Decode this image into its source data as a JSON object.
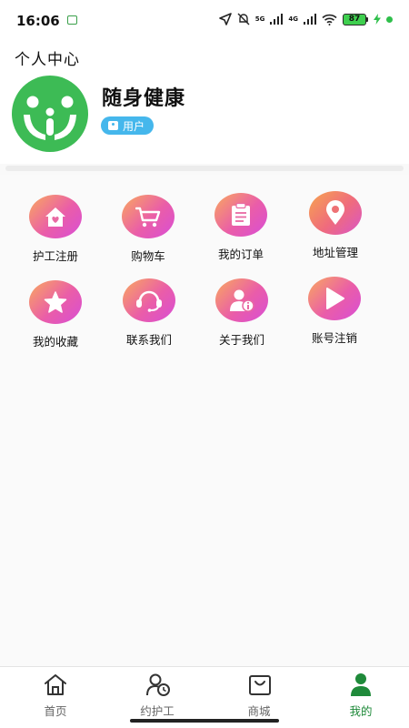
{
  "status_bar": {
    "time": "16:06",
    "network_1": "5G",
    "network_2": "4G",
    "battery": "87"
  },
  "header": {
    "title": "个人中心",
    "app_name": "随身健康",
    "role_badge": "用户",
    "colors": {
      "logo_green": "#3dbb55",
      "badge_blue": "#45b7ec"
    }
  },
  "menu": {
    "items": [
      {
        "label": "护工注册",
        "icon": "house-heart-icon"
      },
      {
        "label": "购物车",
        "icon": "shopping-cart-icon"
      },
      {
        "label": "我的订单",
        "icon": "clipboard-icon"
      },
      {
        "label": "地址管理",
        "icon": "location-pin-icon"
      },
      {
        "label": "我的收藏",
        "icon": "star-icon"
      },
      {
        "label": "联系我们",
        "icon": "headset-icon"
      },
      {
        "label": "关于我们",
        "icon": "user-info-icon"
      },
      {
        "label": "账号注销",
        "icon": "play-icon"
      }
    ]
  },
  "tab_bar": {
    "tabs": [
      {
        "label": "首页",
        "icon": "home-icon",
        "active": false
      },
      {
        "label": "约护工",
        "icon": "caregiver-clock-icon",
        "active": false
      },
      {
        "label": "商城",
        "icon": "shopping-bag-icon",
        "active": false
      },
      {
        "label": "我的",
        "icon": "person-icon",
        "active": true
      }
    ],
    "active_color": "#1f8a3a"
  }
}
